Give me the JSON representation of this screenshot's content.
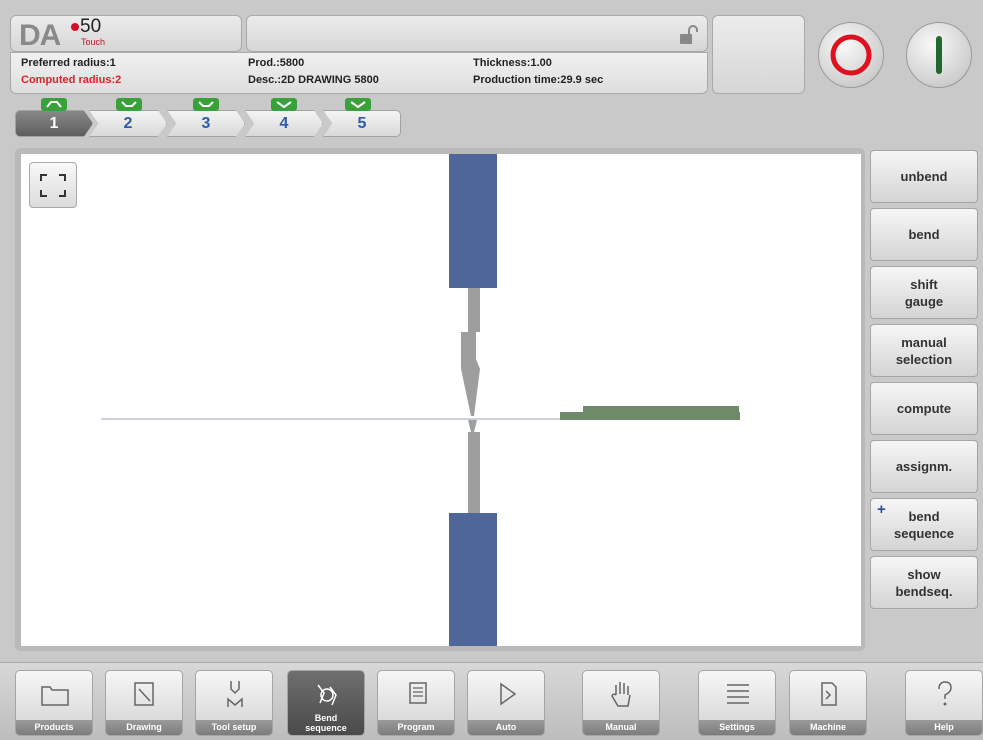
{
  "logo": {
    "brand": "DA",
    "model": "50",
    "edition": "Touch"
  },
  "header": {
    "preferred_radius": "Preferred radius:1",
    "computed_radius": "Computed radius:2",
    "product": "Prod.:5800",
    "description": "Desc.:2D DRAWING 5800",
    "thickness": "Thickness:1.00",
    "production_time": "Production time:29.9 sec"
  },
  "bend_tabs": [
    {
      "label": "1",
      "active": true
    },
    {
      "label": "2",
      "active": false
    },
    {
      "label": "3",
      "active": false
    },
    {
      "label": "4",
      "active": false
    },
    {
      "label": "5",
      "active": false
    }
  ],
  "side_buttons": [
    {
      "label": "unbend"
    },
    {
      "label": "bend"
    },
    {
      "label": "shift\ngauge"
    },
    {
      "label": "manual\nselection"
    },
    {
      "label": "compute"
    },
    {
      "label": "assignm."
    },
    {
      "label": "bend\nsequence",
      "plus": "+"
    },
    {
      "label": "show\nbendseq."
    }
  ],
  "nav": [
    {
      "label": "Products",
      "icon": "folder-icon"
    },
    {
      "label": "Drawing",
      "icon": "drawing-icon"
    },
    {
      "label": "Tool setup",
      "icon": "tool-setup-icon"
    },
    {
      "label": "Bend\nsequence",
      "icon": "bend-sequence-icon",
      "active": true
    },
    {
      "label": "Program",
      "icon": "program-icon"
    },
    {
      "label": "Auto",
      "icon": "play-icon"
    },
    {
      "label": "Manual",
      "icon": "hand-icon"
    },
    {
      "label": "Settings",
      "icon": "list-icon"
    },
    {
      "label": "Machine",
      "icon": "machine-icon"
    },
    {
      "label": "Help",
      "icon": "help-icon"
    }
  ],
  "colors": {
    "accent": "#2d5ba8",
    "alert": "#e3202b",
    "tool": "#4e6699",
    "sheet": "#6f8a68",
    "stop": "#e0101f",
    "start": "#1f6a2c"
  }
}
